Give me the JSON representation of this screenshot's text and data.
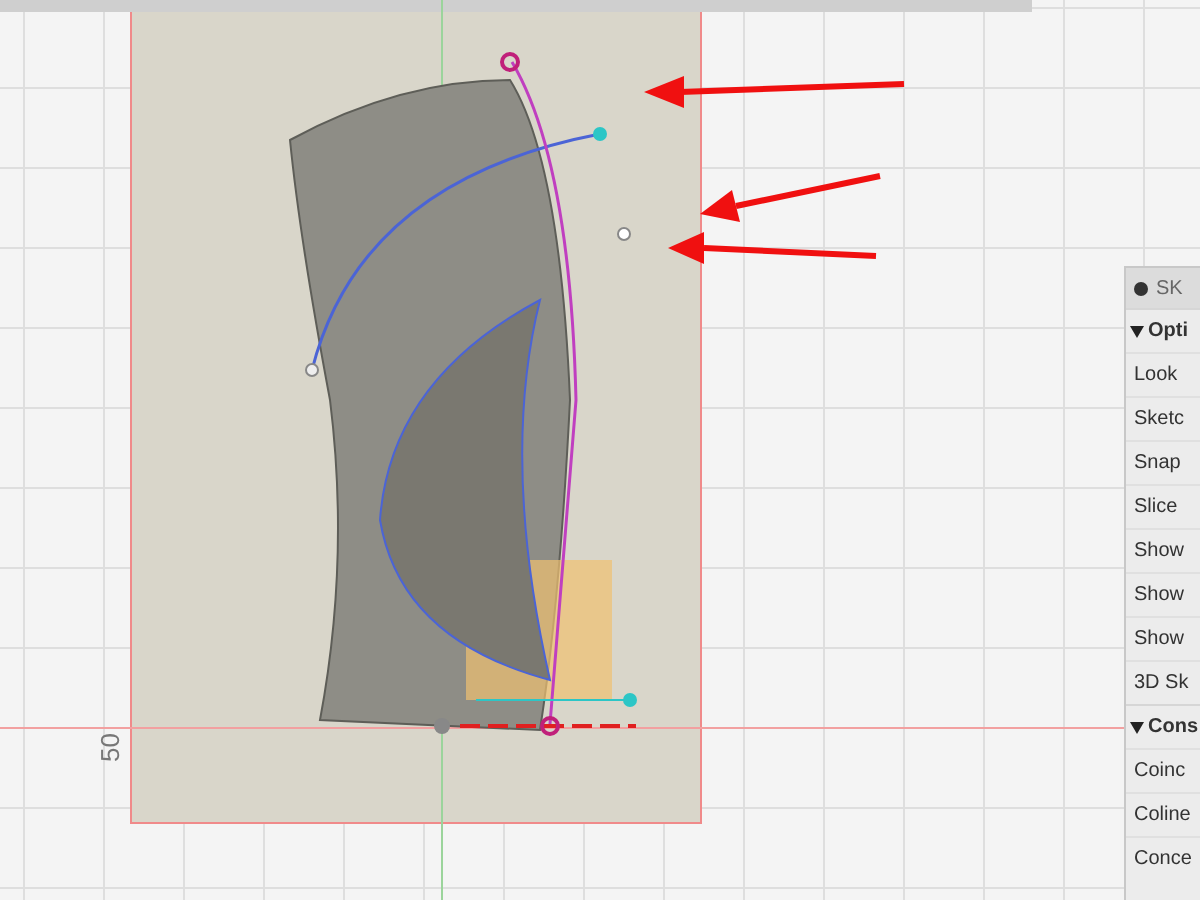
{
  "canvas": {
    "dimension_label": "50"
  },
  "panel": {
    "title": "SK",
    "sections": [
      {
        "label": "Opti",
        "expanded": true,
        "items": [
          "Look",
          "Sketc",
          "Snap",
          "Slice",
          "Show",
          "Show",
          "Show",
          "3D Sk"
        ]
      },
      {
        "label": "Cons",
        "expanded": true,
        "items": [
          "Coinc",
          "Coline",
          "Conce"
        ]
      }
    ]
  }
}
